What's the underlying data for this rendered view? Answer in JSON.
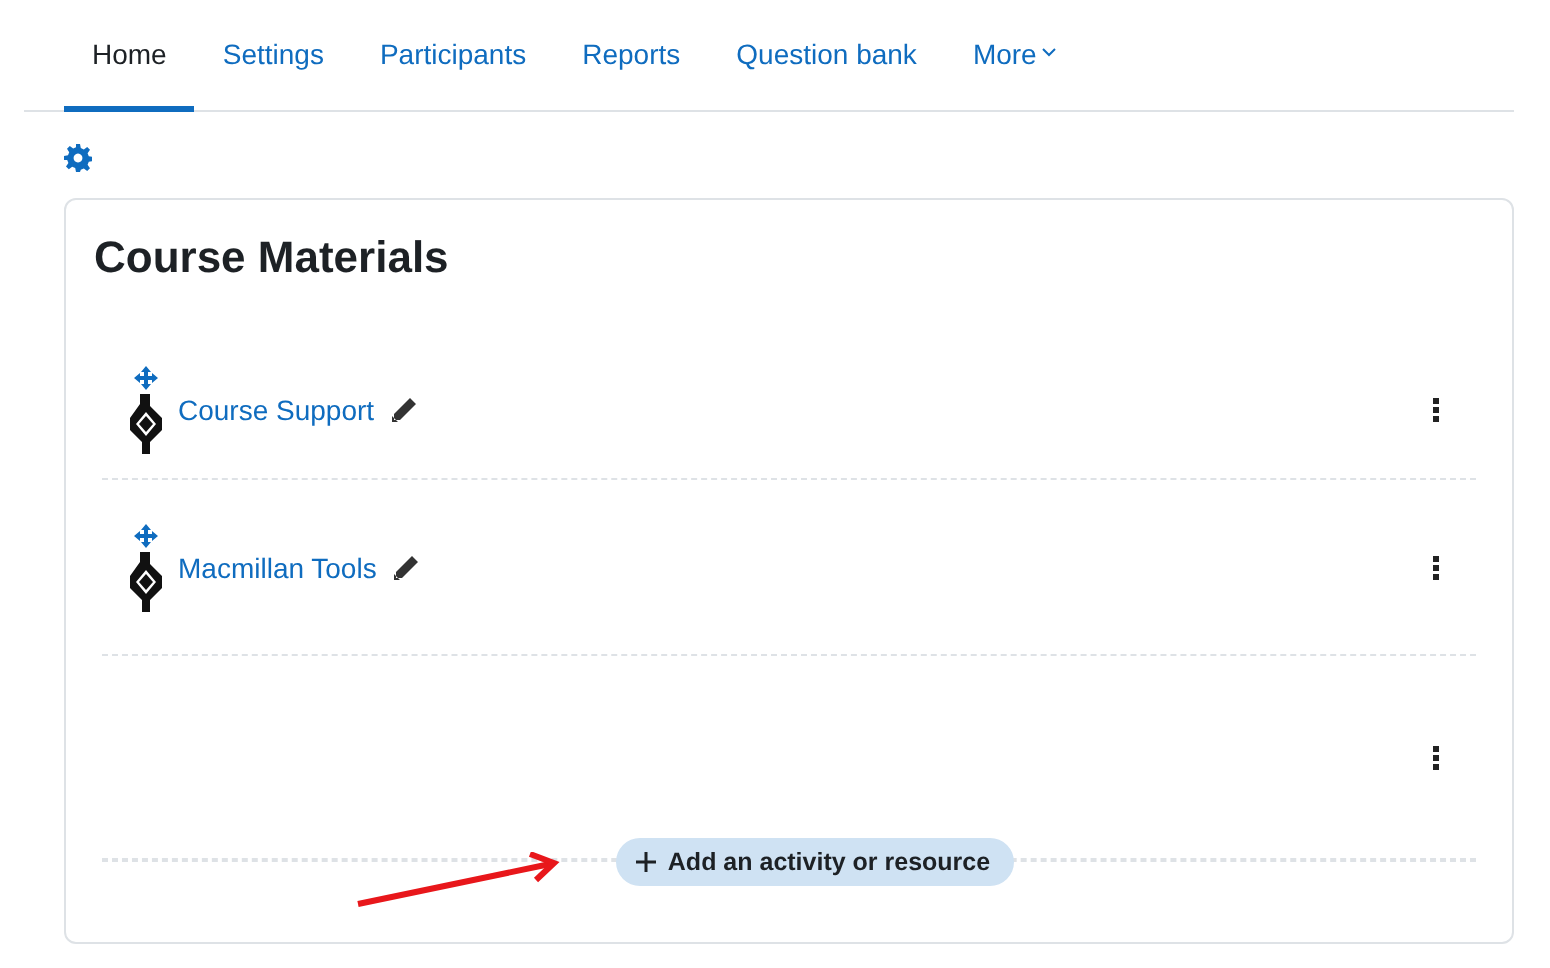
{
  "tabs": [
    {
      "label": "Home",
      "selected": true
    },
    {
      "label": "Settings",
      "selected": false
    },
    {
      "label": "Participants",
      "selected": false
    },
    {
      "label": "Reports",
      "selected": false
    },
    {
      "label": "Question bank",
      "selected": false
    },
    {
      "label": "More",
      "selected": false,
      "kind": "dropdown"
    }
  ],
  "section": {
    "title": "Course Materials",
    "items": [
      {
        "kind": "activity",
        "name": "Course Support"
      },
      {
        "kind": "activity",
        "name": "Macmillan Tools"
      },
      {
        "kind": "empty"
      }
    ],
    "add_button": "Add an activity or resource"
  }
}
